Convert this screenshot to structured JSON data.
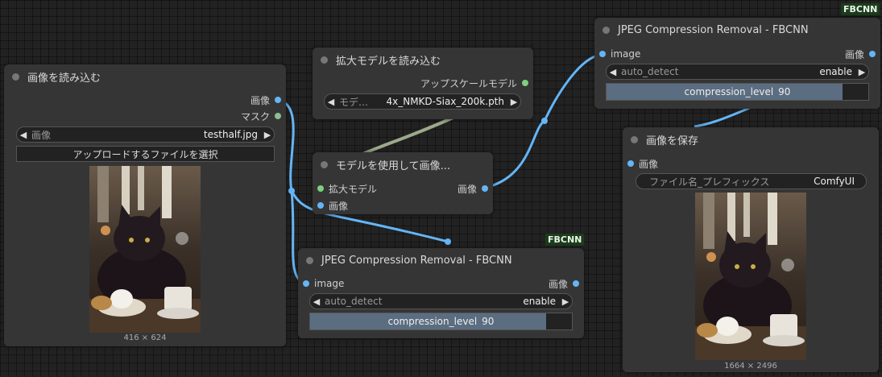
{
  "load_image": {
    "title": "画像を読み込む",
    "out_image": "画像",
    "out_mask": "マスク",
    "combo_label": "画像",
    "combo_value": "testhalf.jpg",
    "upload_button": "アップロードするファイルを選択",
    "size": "416 × 624"
  },
  "load_upscale": {
    "title": "拡大モデルを読み込む",
    "out_model": "アップスケールモデル",
    "combo_label": "モデ…",
    "combo_value": "4x_NMKD-Siax_200k.pth"
  },
  "upscale_with_model": {
    "title": "モデルを使用して画像...",
    "in_model": "拡大モデル",
    "in_image": "画像",
    "out_image": "画像"
  },
  "fbcnn_bottom": {
    "badge": "FBCNN",
    "title": "JPEG Compression Removal - FBCNN",
    "in_image": "image",
    "out_image": "画像",
    "combo_label": "auto_detect",
    "combo_value": "enable",
    "slider_label": "compression_level",
    "slider_value": "90",
    "slider_fraction": 0.9
  },
  "fbcnn_top": {
    "badge": "FBCNN",
    "title": "JPEG Compression Removal - FBCNN",
    "in_image": "image",
    "out_image": "画像",
    "combo_label": "auto_detect",
    "combo_value": "enable",
    "slider_label": "compression_level",
    "slider_value": "90",
    "slider_fraction": 0.9
  },
  "save_image": {
    "title": "画像を保存",
    "in_image": "画像",
    "combo_label": "ファイル名_プレフィックス",
    "combo_value": "ComfyUI",
    "size": "1664 × 2496"
  },
  "colors": {
    "image_link": "#64b5f6",
    "model_link": "#9aaa8a",
    "node_bg": "#353535",
    "canvas_bg": "#222222"
  }
}
